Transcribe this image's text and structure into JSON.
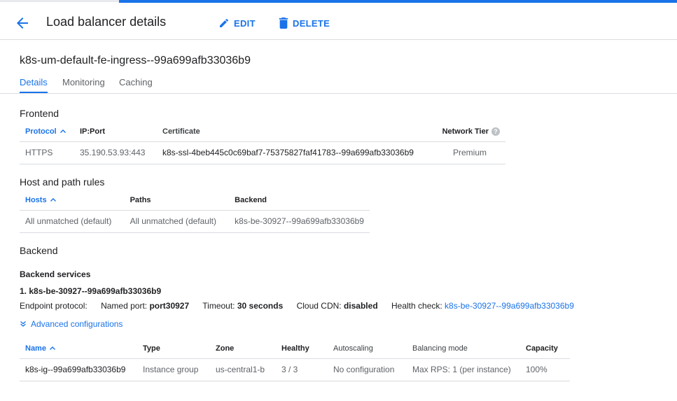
{
  "header": {
    "title": "Load balancer details",
    "edit_label": "EDIT",
    "delete_label": "DELETE"
  },
  "lb_name": "k8s-um-default-fe-ingress--99a699afb33036b9",
  "tabs": [
    "Details",
    "Monitoring",
    "Caching"
  ],
  "frontend": {
    "title": "Frontend",
    "columns": [
      "Protocol",
      "IP:Port",
      "Certificate",
      "Network Tier"
    ],
    "row": {
      "protocol": "HTTPS",
      "ip_port": "35.190.53.93:443",
      "certificate": "k8s-ssl-4beb445c0c69baf7-75375827faf41783--99a699afb33036b9",
      "network_tier": "Premium"
    }
  },
  "host_path": {
    "title": "Host and path rules",
    "columns": [
      "Hosts",
      "Paths",
      "Backend"
    ],
    "row": {
      "hosts": "All unmatched (default)",
      "paths": "All unmatched (default)",
      "backend": "k8s-be-30927--99a699afb33036b9"
    }
  },
  "backend": {
    "title": "Backend",
    "services_label": "Backend services",
    "service_name": "1. k8s-be-30927--99a699afb33036b9",
    "endpoint_protocol_label": "Endpoint protocol:",
    "named_port_label": "Named port:",
    "named_port_value": "port30927",
    "timeout_label": "Timeout:",
    "timeout_value": "30 seconds",
    "cdn_label": "Cloud CDN:",
    "cdn_value": "disabled",
    "health_check_label": "Health check:",
    "health_check_value": "k8s-be-30927--99a699afb33036b9",
    "advanced_label": "Advanced configurations",
    "columns": [
      "Name",
      "Type",
      "Zone",
      "Healthy",
      "Autoscaling",
      "Balancing mode",
      "Capacity"
    ],
    "row": {
      "name": "k8s-ig--99a699afb33036b9",
      "type": "Instance group",
      "zone": "us-central1-b",
      "healthy": "3 / 3",
      "autoscaling": "No configuration",
      "balancing_mode": "Max RPS: 1 (per instance)",
      "capacity": "100%"
    }
  },
  "colors": {
    "accent": "#1a73e8",
    "text": "#202124",
    "muted": "#5f6368",
    "divider": "#dadce0"
  }
}
